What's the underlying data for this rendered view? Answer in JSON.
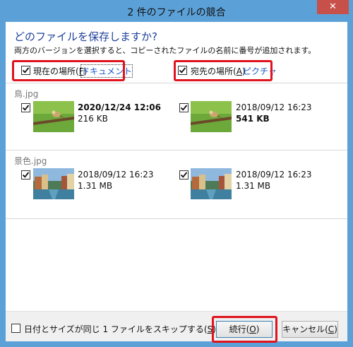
{
  "window": {
    "title": "2 件のファイルの競合",
    "close_glyph": "✕"
  },
  "dialog": {
    "heading": "どのファイルを保存しますか?",
    "description": "両方のバージョンを選択すると、コピーされたファイルの名前に番号が追加されます。"
  },
  "source": {
    "label": "現在の場所",
    "mnemonic_prefix": "(",
    "mnemonic": "F",
    "mnemonic_suffix": ")",
    "folder": "ドキュメント",
    "checked": true
  },
  "destination": {
    "label": "宛先の場所",
    "mnemonic_prefix": "(",
    "mnemonic": "A",
    "mnemonic_suffix": ")",
    "folder": "ピクチャ",
    "checked": true
  },
  "files": [
    {
      "name": "鳥.jpg",
      "left": {
        "date": "2020/12/24 12:06",
        "size": "216 KB",
        "checked": true
      },
      "right": {
        "date": "2018/09/12 16:23",
        "size": "541 KB",
        "checked": true
      }
    },
    {
      "name": "景色.jpg",
      "left": {
        "date": "2018/09/12 16:23",
        "size": "1.31 MB",
        "checked": true
      },
      "right": {
        "date": "2018/09/12 16:23",
        "size": "1.31 MB",
        "checked": true
      }
    }
  ],
  "footer": {
    "skip_label_prefix": "日付とサイズが同じ 1 ファイルをスキップする(",
    "skip_mnemonic": "S",
    "skip_label_suffix": ")",
    "continue_prefix": "続行(",
    "continue_mnemonic": "O",
    "continue_suffix": ")",
    "cancel_prefix": "キャンセル(",
    "cancel_mnemonic": "C",
    "cancel_suffix": ")"
  },
  "colors": {
    "highlight": "#e0141e",
    "titlebar": "#5ba1d8",
    "link": "#1a56c8",
    "heading": "#1e3f9b"
  }
}
